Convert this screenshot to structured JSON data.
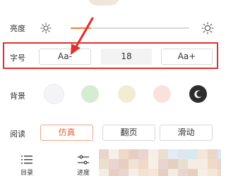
{
  "settings": {
    "brightness": {
      "label": "亮度",
      "level": 0.17,
      "low_icon": "sun-outline-icon",
      "high_icon": "sun-outline-icon"
    },
    "font_size": {
      "label": "字号",
      "decrease_label": "Aa-",
      "value": "18",
      "increase_label": "Aa+"
    },
    "background": {
      "label": "背景",
      "swatches": [
        {
          "name": "white",
          "color": "#f4f4f6",
          "selected": true
        },
        {
          "name": "green",
          "color": "#d5ecd3",
          "selected": false
        },
        {
          "name": "beige",
          "color": "#f3ecd5",
          "selected": false
        },
        {
          "name": "pink",
          "color": "#fbe1dc",
          "selected": false
        },
        {
          "name": "night",
          "color": "#2d2d2d",
          "selected": false,
          "icon": "moon-icon"
        }
      ]
    },
    "reading": {
      "label": "阅读",
      "modes": [
        {
          "label": "仿真",
          "active": true
        },
        {
          "label": "翻页",
          "active": false
        },
        {
          "label": "滑动",
          "active": false
        }
      ]
    }
  },
  "bottom_nav": {
    "items": [
      {
        "label": "目录",
        "icon": "list-icon"
      },
      {
        "label": "进度",
        "icon": "sliders-icon"
      }
    ]
  },
  "colors": {
    "accent": "#f07a3d",
    "highlight_box": "#e0312e",
    "arrow": "#e0312e"
  }
}
